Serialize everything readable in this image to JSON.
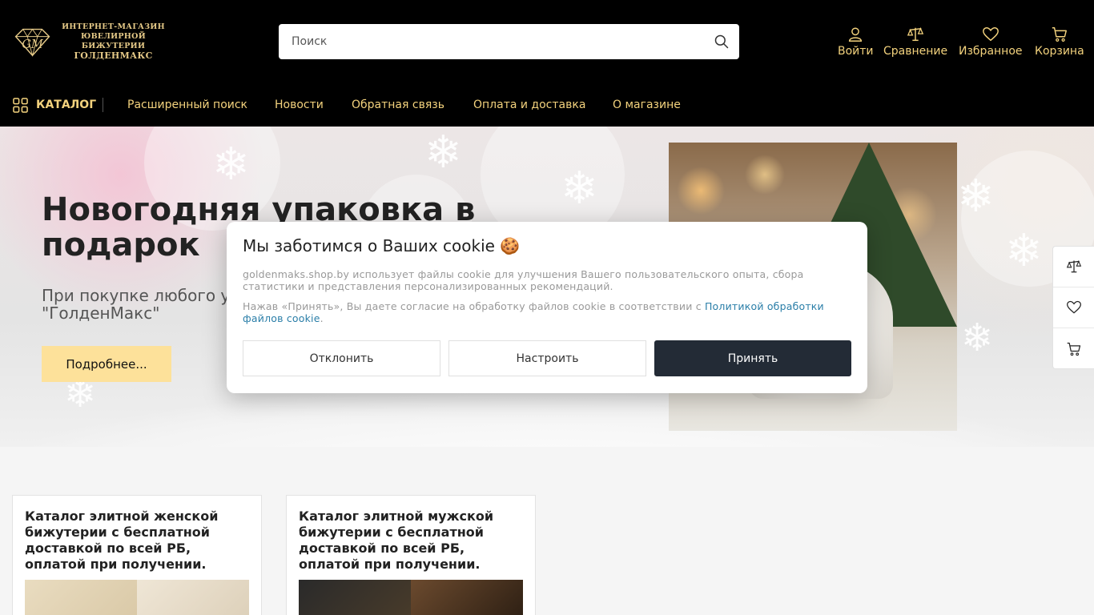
{
  "header": {
    "logo": {
      "line1": "ИНТЕРНЕТ-МАГАЗИН",
      "line2": "ЮВЕЛИРНОЙ БИЖУТЕРИИ",
      "line3": "ГОЛДЕНМАКС"
    },
    "search": {
      "placeholder": "Поиск"
    },
    "actions": {
      "login": "Войти",
      "compare": "Сравнение",
      "favorites": "Избранное",
      "cart": "Корзина"
    },
    "accent_color": "#f3d27d"
  },
  "nav": {
    "catalog": "КАТАЛОГ",
    "links": [
      "Расширенный поиск",
      "Новости",
      "Обратная связь",
      "Оплата и доставка",
      "О магазине"
    ]
  },
  "banner": {
    "title": "Новогодняя упаковка в подарок",
    "subtitle": "При покупке любого ук... \"ГолденМакс\"",
    "subtitle_line1": "При покупке любого ук",
    "subtitle_line2": "\"ГолденМакс\"",
    "button": "Подробнее..."
  },
  "cookie": {
    "title": "Мы заботимся о Ваших cookie 🍪",
    "text1": "goldenmaks.shop.by использует файлы cookie для улучшения Вашего пользовательского опыта, сбора статистики и представления персонализированных рекомендаций.",
    "text2_prefix": "Нажав «Принять», Вы даете согласие на обработку файлов cookie в соответствии с ",
    "text2_link": "Политикой обработки файлов cookie",
    "text2_suffix": ".",
    "decline": "Отклонить",
    "configure": "Настроить",
    "accept": "Принять"
  },
  "categories": [
    {
      "title": "Каталог элитной женской бижутерии с бесплатной доставкой по всей РБ, оплатой при получении."
    },
    {
      "title": "Каталог элитной мужской бижутерии с бесплатной доставкой по всей РБ, оплатой при получении."
    }
  ],
  "side_widgets": [
    "compare-icon",
    "heart-icon",
    "cart-icon"
  ]
}
